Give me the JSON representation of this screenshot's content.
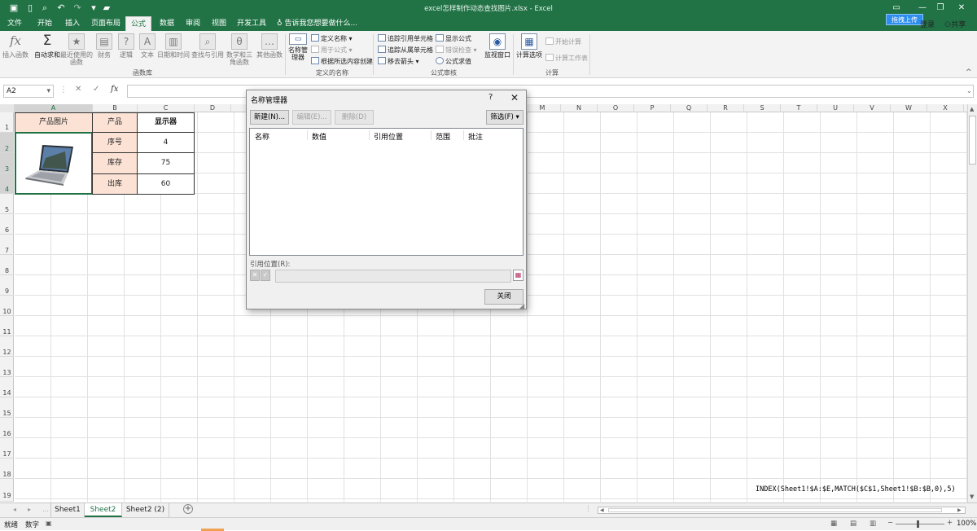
{
  "titlebar": {
    "title": "excel怎样制作动态查找图片.xlsx - Excel",
    "upload": "拖拽上传",
    "login": "登录",
    "share": "共享",
    "restore_icon": "restore-icon",
    "close_icon": "close-icon"
  },
  "tabs": [
    "文件",
    "开始",
    "插入",
    "页面布局",
    "公式",
    "数据",
    "审阅",
    "视图",
    "开发工具"
  ],
  "active_tab": "公式",
  "tellme": "告诉我您想要做什么...",
  "ribbon": {
    "insert_function": "插入函数",
    "autosum": "自动求和",
    "recent": "最近使用的函数",
    "finance": "财务",
    "logic": "逻辑",
    "text": "文本",
    "datetime": "日期和时间",
    "lookup": "查找与引用",
    "math": "数学和三角函数",
    "other": "其他函数",
    "group_library": "函数库",
    "name_manager": "名称管理器",
    "define_name": "定义名称",
    "use_in_formula": "用于公式",
    "create_from_sel": "根据所选内容创建",
    "group_names": "定义的名称",
    "trace_precedents": "追踪引用单元格",
    "trace_dependents": "追踪从属单元格",
    "remove_arrows": "移去箭头",
    "show_formulas": "显示公式",
    "error_check": "错误检查",
    "evaluate": "公式求值",
    "group_audit": "公式审核",
    "watch": "监视窗口",
    "calc_options": "计算选项",
    "calc_now": "开始计算",
    "calc_sheet": "计算工作表",
    "group_calc": "计算"
  },
  "formula_bar": {
    "name_box": "A2",
    "fx": "fx",
    "content": ""
  },
  "columns": [
    "A",
    "B",
    "C",
    "D",
    "E",
    "F",
    "G",
    "H",
    "I",
    "J",
    "K",
    "L",
    "M",
    "N",
    "O",
    "P",
    "Q",
    "R",
    "S",
    "T",
    "U",
    "V",
    "W",
    "X"
  ],
  "rows": [
    "1",
    "2",
    "3",
    "4",
    "5",
    "6",
    "7",
    "8",
    "9",
    "10",
    "11",
    "12",
    "13",
    "14",
    "15",
    "16",
    "17",
    "18",
    "19"
  ],
  "cells": {
    "a1": "产品图片",
    "b1": "产品",
    "c1": "显示器",
    "b2": "序号",
    "c2": "4",
    "b3": "库存",
    "c3": "75",
    "b4": "出库",
    "c4": "60"
  },
  "dialog": {
    "title": "名称管理器",
    "help": "?",
    "close": "✕",
    "new_btn": "新建(N)...",
    "edit_btn": "编辑(E)...",
    "delete_btn": "删除(D)",
    "filter_btn": "筛选(F) ▾",
    "col_name": "名称",
    "col_value": "数值",
    "col_ref": "引用位置",
    "col_scope": "范围",
    "col_comment": "批注",
    "ref_label": "引用位置(R):",
    "close_btn": "关闭"
  },
  "formula_note": "INDEX(Sheet1!$A:$E,MATCH($C$1,Sheet1!$B:$B,0),5)",
  "sheets": [
    "Sheet1",
    "Sheet2",
    "Sheet2 (2)"
  ],
  "active_sheet": "Sheet2",
  "status": {
    "ready": "就绪",
    "num": "数字",
    "zoom": "100%"
  }
}
